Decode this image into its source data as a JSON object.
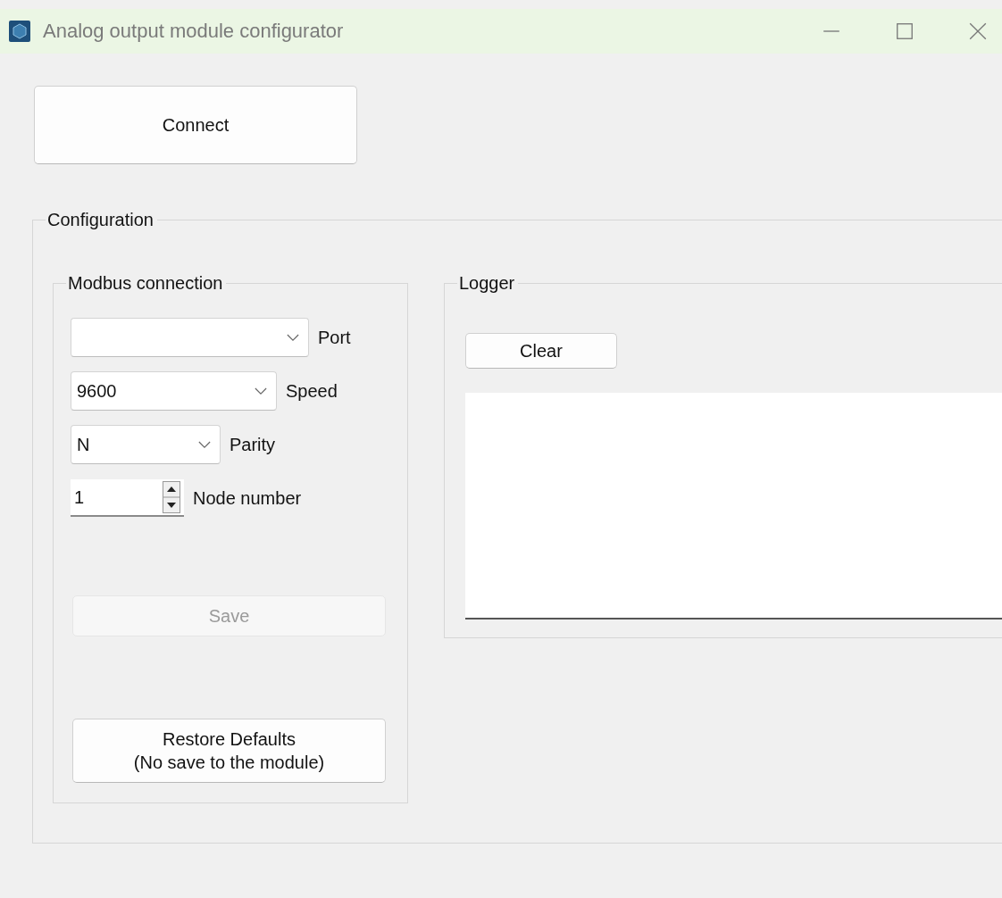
{
  "window": {
    "title": "Analog output module configurator"
  },
  "connect_button": {
    "label": "Connect",
    "disabled": false
  },
  "configuration": {
    "title": "Configuration",
    "modbus": {
      "title": "Modbus connection",
      "fields": [
        {
          "kind": "combo",
          "label": "Port"
        },
        {
          "kind": "combo",
          "label": "Speed",
          "value": "9600"
        },
        {
          "kind": "combo",
          "label": "Parity",
          "value": "N"
        },
        {
          "kind": "spin",
          "label": "Node number",
          "value": "1"
        }
      ],
      "save_button": {
        "label": "Save",
        "disabled": true
      },
      "restore_button": {
        "label": "Restore Defaults\n(No save to the module)",
        "disabled": false
      }
    },
    "logger": {
      "title": "Logger",
      "clear_button": {
        "label": "Clear",
        "disabled": false
      }
    }
  }
}
